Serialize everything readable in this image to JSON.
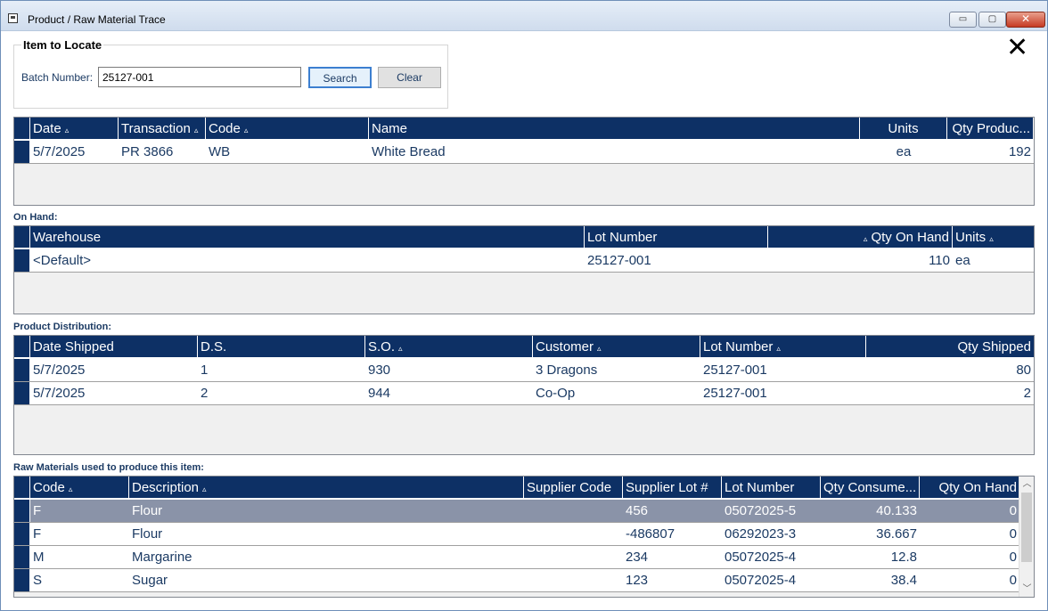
{
  "window": {
    "title": "Product / Raw Material Trace"
  },
  "locate": {
    "group_title": "Item to Locate",
    "batch_label": "Batch Number:",
    "batch_value": "25127-001",
    "search_label": "Search",
    "clear_label": "Clear"
  },
  "product_grid": {
    "headers": [
      "Date",
      "Transaction",
      "Code",
      "Name",
      "Units",
      "Qty Produc..."
    ],
    "rows": [
      [
        "5/7/2025",
        "PR 3866",
        "WB",
        "White Bread",
        "ea",
        "192"
      ]
    ]
  },
  "on_hand": {
    "label": "On Hand:",
    "headers": [
      "Warehouse",
      "Lot Number",
      "Qty On Hand",
      "Units"
    ],
    "rows": [
      [
        "<Default>",
        "25127-001",
        "110",
        "ea"
      ]
    ]
  },
  "distribution": {
    "label": "Product Distribution:",
    "headers": [
      "Date Shipped",
      "D.S.",
      "S.O.",
      "Customer",
      "Lot Number",
      "Qty Shipped"
    ],
    "rows": [
      [
        "5/7/2025",
        "1",
        "930",
        "3 Dragons",
        "25127-001",
        "80"
      ],
      [
        "5/7/2025",
        "2",
        "944",
        "Co-Op",
        "25127-001",
        "2"
      ]
    ]
  },
  "raw_materials": {
    "label": "Raw Materials used to produce this item:",
    "headers": [
      "Code",
      "Description",
      "Supplier Code",
      "Supplier Lot #",
      "Lot Number",
      "Qty Consume...",
      "Qty On Hand"
    ],
    "rows": [
      [
        "F",
        "Flour",
        "",
        "456",
        "05072025-5",
        "40.133",
        "0"
      ],
      [
        "F",
        "Flour",
        "",
        "-486807",
        "06292023-3",
        "36.667",
        "0"
      ],
      [
        "M",
        "Margarine",
        "",
        "234",
        "05072025-4",
        "12.8",
        "0"
      ],
      [
        "S",
        "Sugar",
        "",
        "123",
        "05072025-4",
        "38.4",
        "0"
      ]
    ]
  },
  "icons": {
    "sort": "sort-triangle-icon",
    "close": "close-x-icon",
    "scroll_up": "chevron-up-icon",
    "scroll_down": "chevron-down-icon"
  },
  "colors": {
    "header_bg": "#0d3065",
    "selected_row": "#8a93a8",
    "text_blue": "#1b3a63"
  },
  "glyphs": {
    "sort": "▵",
    "close": "✕",
    "minimize": "▭",
    "maximize": "▢",
    "window_close": "✕",
    "scroll_up": "︿",
    "scroll_down": "﹀"
  }
}
